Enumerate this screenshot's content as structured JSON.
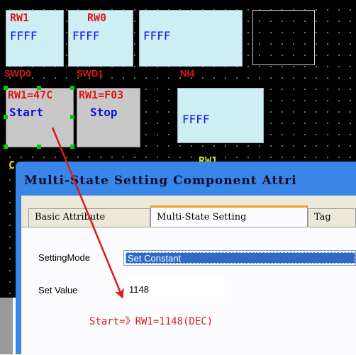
{
  "canvas": {
    "tiles": [
      {
        "label": "RW1",
        "value": "FFFF"
      },
      {
        "label": "RW0",
        "value": "FFFF"
      },
      {
        "label": "",
        "value": "FFFF"
      }
    ],
    "swd_labels": [
      "SWD0",
      "SWD1",
      "NI4"
    ],
    "ni4_value": "FFFF",
    "buttons": [
      {
        "top": "RW1=47C",
        "bottom": "Start"
      },
      {
        "top": "RW1=F03",
        "bottom": "Stop"
      }
    ],
    "partial_text": "RW1"
  },
  "dialog": {
    "title": "Multi-State Setting Component Attri",
    "tabs": [
      "Basic Attribute",
      "Multi-State Setting",
      "Tag"
    ],
    "setting_mode_label": "SettingMode",
    "setting_mode_value": "Set Constant",
    "set_value_label": "Set Value",
    "set_value": "1148",
    "hint": "Start=》RW1=1148(DEC)"
  },
  "colors": {
    "tile_bg": "#cdeef2",
    "label_red": "#e01818",
    "value_blue": "#1010e0",
    "title_blue": "#3a86e8",
    "tab_highlight": "#f0a020",
    "selection": "#316ac5"
  }
}
